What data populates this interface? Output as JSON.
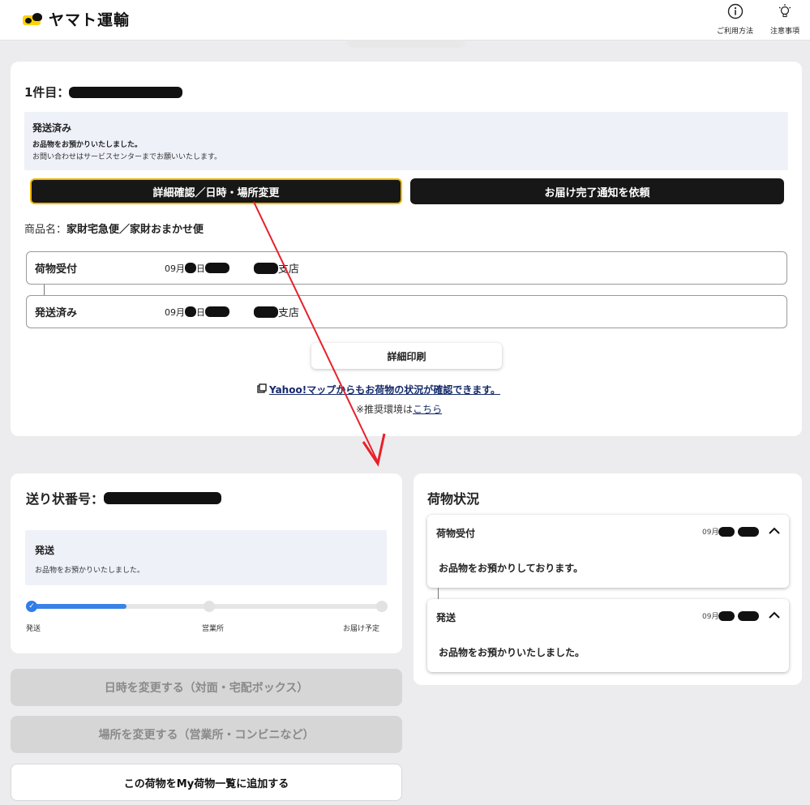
{
  "header": {
    "logo_text": "ヤマト運輸",
    "usage_label": "ご利用方法",
    "notes_label": "注意事項"
  },
  "item1": {
    "title_prefix": "1件目：",
    "status_title": "発送済み",
    "status_line1": "お品物をお預かりいたしました。",
    "status_line2": "お問い合わせはサービスセンターまでお願いいたします。",
    "detail_button": "詳細確認／日時・場所変更",
    "notify_button": "お届け完了通知を依頼",
    "product_label": "商品名：",
    "product_name": "家財宅急便／家財おまかせ便",
    "history": [
      {
        "name": "荷物受付",
        "date_prefix": "09月",
        "date_mid": "日",
        "branch_suffix": "支店"
      },
      {
        "name": "発送済み",
        "date_prefix": "09月",
        "date_mid": "日",
        "branch_suffix": "支店"
      }
    ],
    "print_button": "詳細印刷",
    "yahoo_link": "Yahoo!マップからもお荷物の状況が確認できます。",
    "env_text": "※推奨環境は",
    "env_link": "こちら"
  },
  "slip": {
    "title_prefix": "送り状番号：",
    "status_title": "発送",
    "status_line": "お品物をお預かりいたしました。",
    "progress_steps": [
      "発送",
      "営業所",
      "お届け予定"
    ],
    "progress_value": 0.27,
    "date_button": "日時を変更する（対面・宅配ボックス）",
    "place_button": "場所を変更する（営業所・コンビニなど）",
    "add_button": "この荷物をMy荷物一覧に追加する"
  },
  "status_panel": {
    "title": "荷物状況",
    "entries": [
      {
        "name": "荷物受付",
        "date_prefix": "09月",
        "message": "お品物をお預かりしております。"
      },
      {
        "name": "発送",
        "date_prefix": "09月",
        "message": "お品物をお預かりいたしました。"
      }
    ]
  },
  "colors": {
    "accent_arrow": "#e8202a",
    "button_dark": "#171717",
    "highlight_border": "#f2b600",
    "progress_blue": "#3b82e8",
    "status_bg": "#eff1f9"
  }
}
